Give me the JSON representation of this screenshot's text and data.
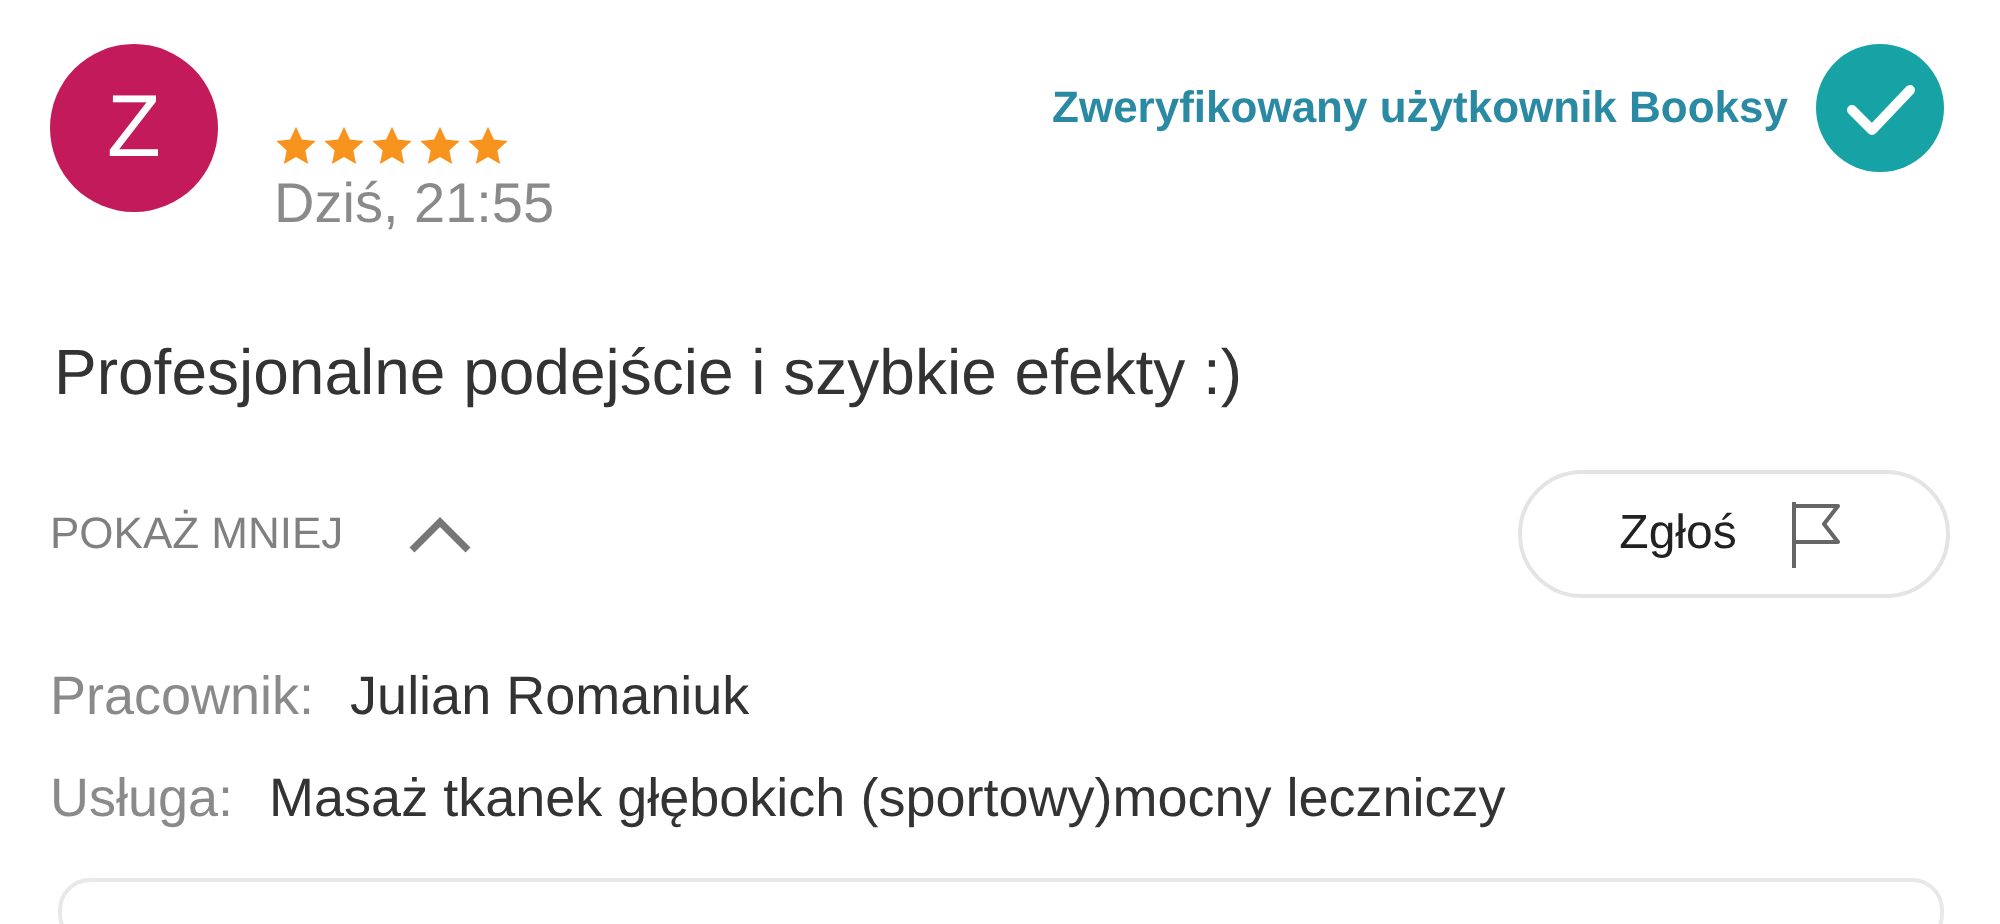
{
  "review": {
    "avatar_letter": "Z",
    "stars": 5,
    "date": "Dziś, 21:55",
    "verified": {
      "label": "Zweryfikowany użytkownik Booksy"
    },
    "text": "Profesjonalne podejście i szybkie efekty :)",
    "toggle": {
      "label": "POKAŻ MNIEJ",
      "expanded": true
    },
    "report_button": {
      "label": "Zgłoś"
    },
    "details": [
      {
        "label": "Pracownik:",
        "value": "Julian Romaniuk"
      },
      {
        "label": "Usługa:",
        "value": "Masaż tkanek głębokich (sportowy)mocny leczniczy"
      }
    ]
  }
}
